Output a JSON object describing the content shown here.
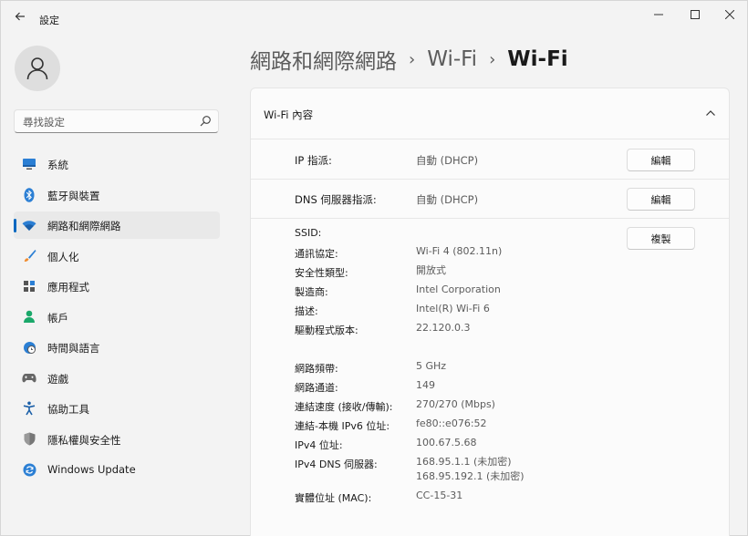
{
  "window": {
    "title": "設定"
  },
  "sidebar": {
    "search_placeholder": "尋找設定",
    "items": [
      {
        "label": "系統",
        "icon": "monitor-icon"
      },
      {
        "label": "藍牙與裝置",
        "icon": "bluetooth-icon"
      },
      {
        "label": "網路和網際網路",
        "icon": "wifi-icon",
        "active": true
      },
      {
        "label": "個人化",
        "icon": "brush-icon"
      },
      {
        "label": "應用程式",
        "icon": "apps-icon"
      },
      {
        "label": "帳戶",
        "icon": "person-icon"
      },
      {
        "label": "時間與語言",
        "icon": "globe-clock-icon"
      },
      {
        "label": "遊戲",
        "icon": "gamepad-icon"
      },
      {
        "label": "協助工具",
        "icon": "accessibility-icon"
      },
      {
        "label": "隱私權與安全性",
        "icon": "shield-icon"
      },
      {
        "label": "Windows Update",
        "icon": "update-icon"
      }
    ]
  },
  "breadcrumb": {
    "items": [
      "網路和網際網路",
      "Wi-Fi"
    ],
    "current": "Wi-Fi"
  },
  "wifi_properties": {
    "title": "Wi-Fi 內容",
    "ip_assignment": {
      "label": "IP 指派:",
      "value": "自動 (DHCP)",
      "button": "編輯"
    },
    "dns_assignment": {
      "label": "DNS 伺服器指派:",
      "value": "自動 (DHCP)",
      "button": "編輯"
    },
    "copy_button": "複製",
    "props_1": [
      {
        "label": "SSID:",
        "value": ""
      },
      {
        "label": "通訊協定:",
        "value": "Wi-Fi 4 (802.11n)"
      },
      {
        "label": "安全性類型:",
        "value": "開放式"
      },
      {
        "label": "製造商:",
        "value": "Intel Corporation"
      },
      {
        "label": "描述:",
        "value": "Intel(R) Wi-Fi 6"
      },
      {
        "label": "驅動程式版本:",
        "value": "22.120.0.3"
      }
    ],
    "props_2": [
      {
        "label": "網路頻帶:",
        "value": "5 GHz"
      },
      {
        "label": "網路通道:",
        "value": "149"
      },
      {
        "label": "連結速度 (接收/傳輸):",
        "value": "270/270 (Mbps)"
      },
      {
        "label": "連結-本機 IPv6 位址:",
        "value": "fe80::e076:52"
      },
      {
        "label": "IPv4 位址:",
        "value": "100.67.5.68"
      },
      {
        "label": "IPv4 DNS 伺服器:",
        "value": "168.95.1.1 (未加密)",
        "value2": "168.95.192.1 (未加密)"
      },
      {
        "label": "實體位址 (MAC):",
        "value": "CC-15-31"
      }
    ]
  },
  "colors": {
    "accent": "#0067c0",
    "background": "#f3f3f3",
    "card": "#fbfbfb"
  }
}
